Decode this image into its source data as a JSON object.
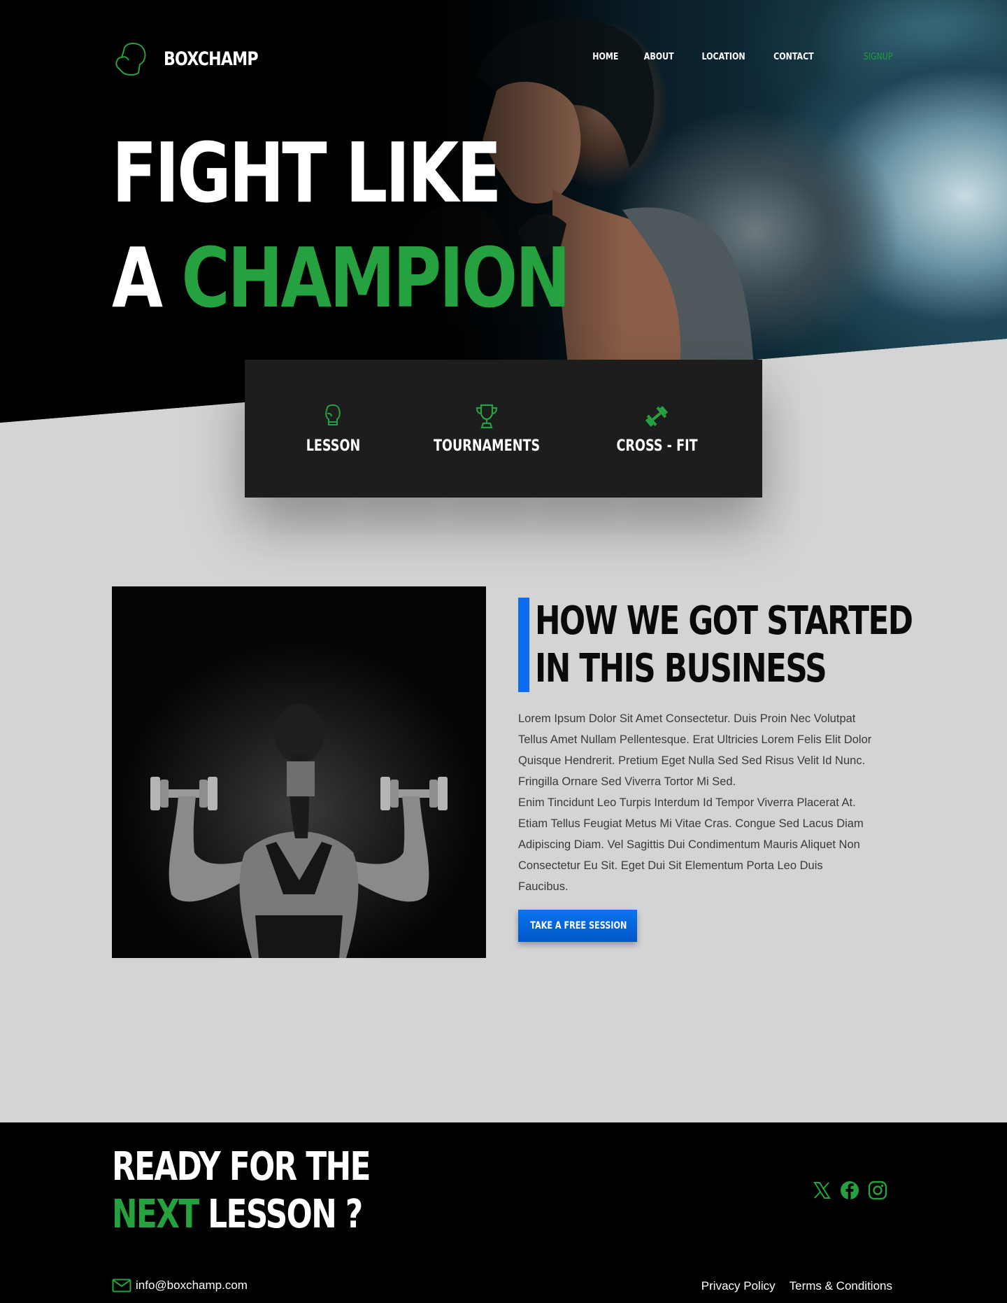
{
  "brand": {
    "name": "BOXCHAMP",
    "accent_color": "#26a13f",
    "cta_color": "#0b6ef0"
  },
  "nav": {
    "links": [
      "HOME",
      "ABOUT",
      "LOCATION",
      "CONTACT"
    ],
    "signup": "SIGNUP"
  },
  "hero": {
    "line1": "FIGHT LIKE",
    "line2_prefix": "A",
    "line2_accent": "CHAMPION",
    "image": "boxer-woman-photo"
  },
  "services": [
    {
      "icon": "boxing-glove-icon",
      "label": "LESSON"
    },
    {
      "icon": "trophy-icon",
      "label": "TOURNAMENTS"
    },
    {
      "icon": "dumbbell-icon",
      "label": "CROSS - FIT"
    }
  ],
  "about": {
    "image": "woman-dumbbells-photo",
    "heading_line1": "HOW WE GOT STARTED",
    "heading_line2": "IN THIS  BUSINESS",
    "paragraph1": "Lorem Ipsum Dolor Sit Amet Consectetur. Duis Proin Nec Volutpat Tellus Amet Nullam Pellentesque. Erat Ultricies Lorem Felis Elit Dolor Quisque Hendrerit. Pretium Eget Nulla Sed Sed Risus Velit Id Nunc. Fringilla Ornare Sed Viverra Tortor Mi Sed.",
    "paragraph2": "Enim Tincidunt Leo Turpis Interdum Id Tempor Viverra Placerat At. Etiam Tellus Feugiat Metus Mi Vitae Cras. Congue Sed Lacus Diam Adipiscing Diam. Vel Sagittis Dui Condimentum Mauris Aliquet Non Consectetur Eu Sit. Eget Dui Sit Elementum Porta Leo Duis Faucibus.",
    "cta": "TAKE A FREE SESSION"
  },
  "footer": {
    "line1": "READY FOR THE",
    "line2_accent": "NEXT",
    "line2_rest": "LESSON ?",
    "socials": [
      "x-icon",
      "facebook-icon",
      "instagram-icon"
    ],
    "email": "info@boxchamp.com",
    "links": [
      "Privacy Policy",
      "Terms & Conditions"
    ]
  }
}
